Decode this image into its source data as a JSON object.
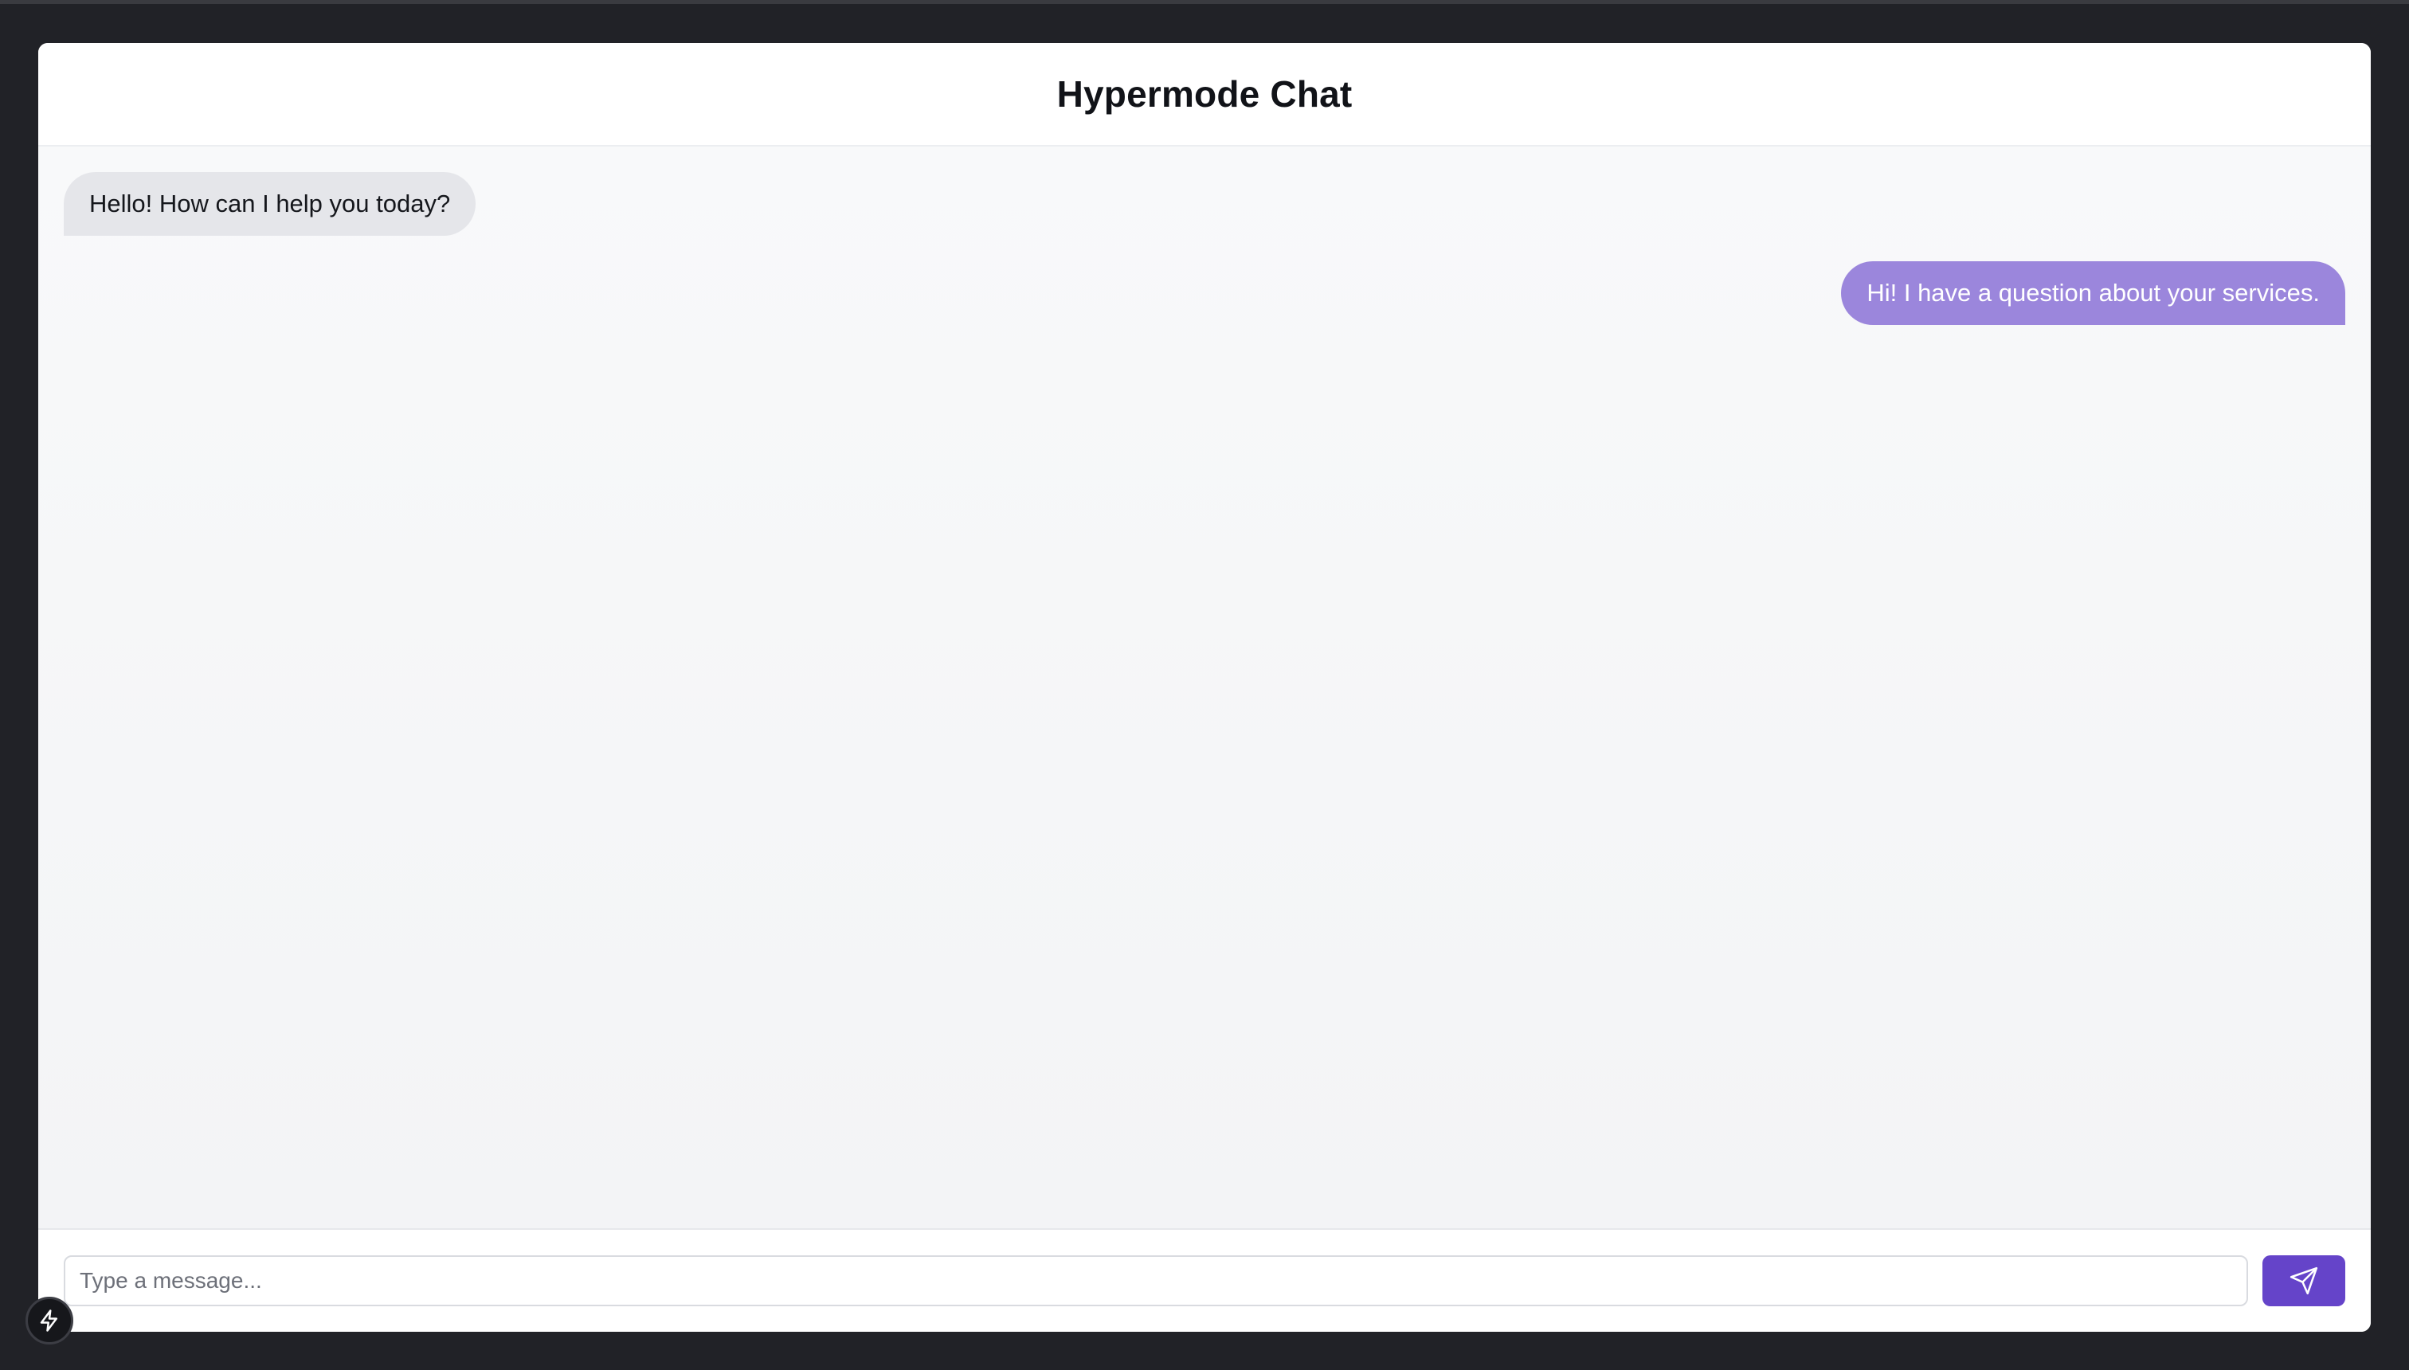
{
  "header": {
    "title": "Hypermode Chat"
  },
  "messages": [
    {
      "sender": "bot",
      "text": "Hello! How can I help you today?"
    },
    {
      "sender": "user",
      "text": "Hi! I have a question about your services."
    }
  ],
  "composer": {
    "placeholder": "Type a message...",
    "value": "",
    "send_icon": "send-icon"
  },
  "badge": {
    "icon": "lightning-icon"
  },
  "colors": {
    "background": "#212227",
    "bot_bubble": "#e5e6ea",
    "user_bubble": "#9b86dc",
    "send_button": "#6544c9"
  }
}
